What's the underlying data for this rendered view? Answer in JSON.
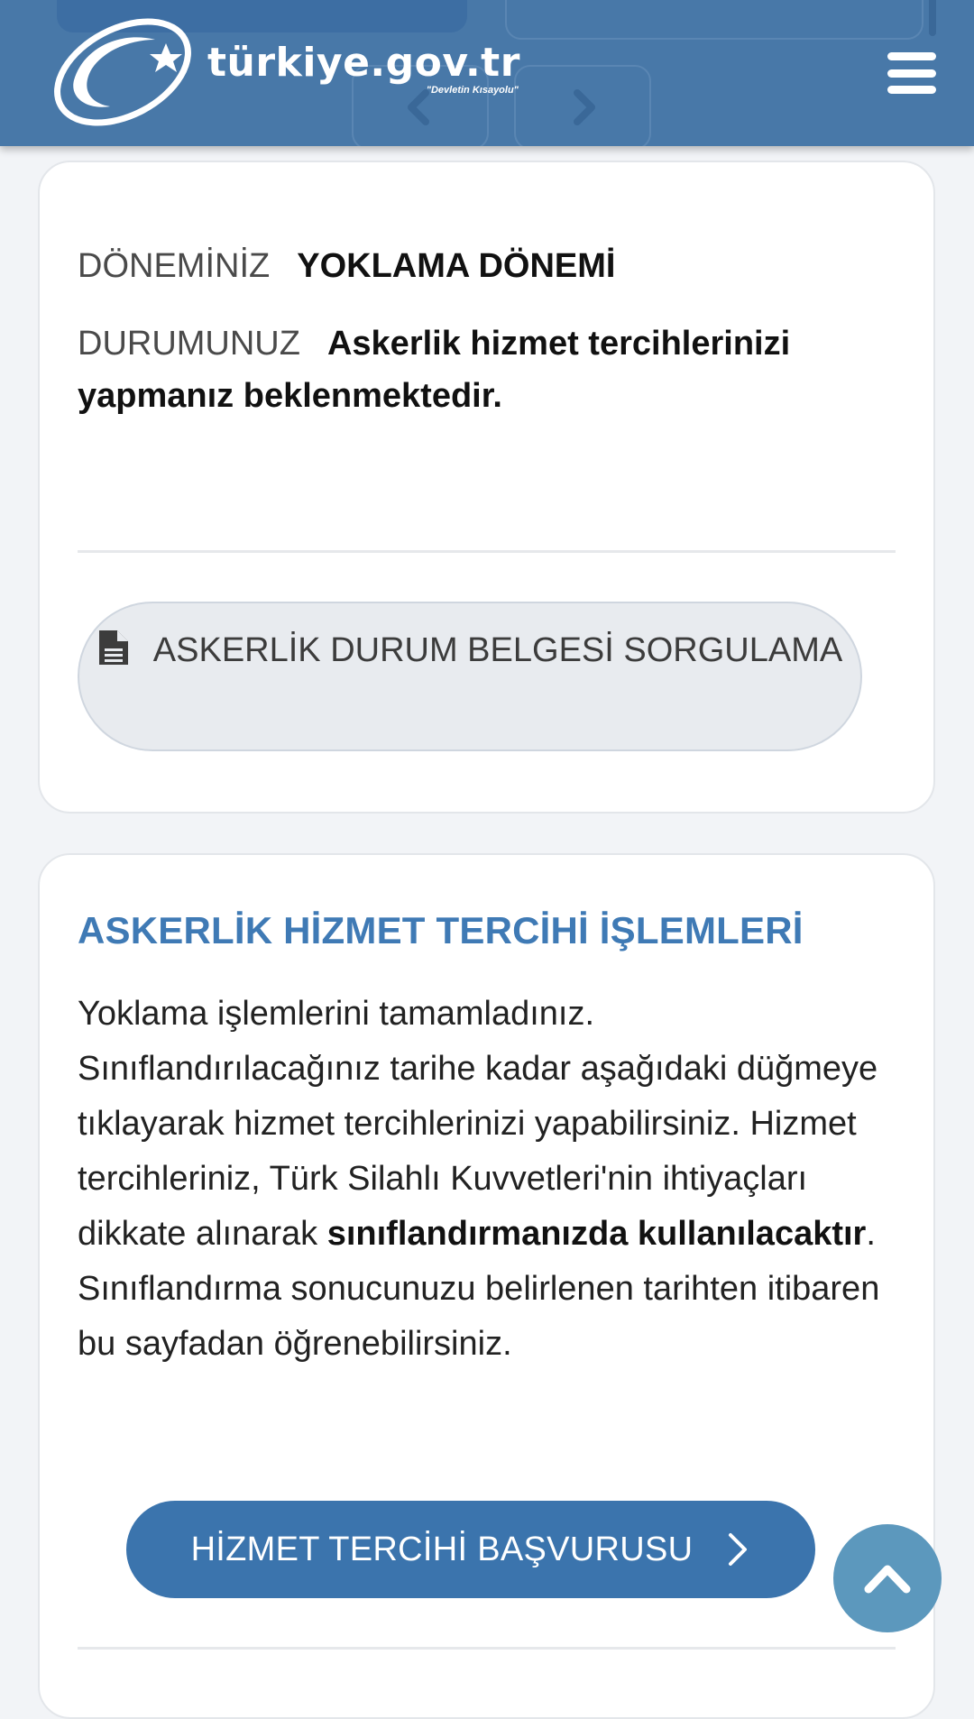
{
  "header": {
    "logo_name": "türkiye.gov.tr",
    "logo_slogan": "\"Devletin Kısayolu\"",
    "brand_color": "#4878a8"
  },
  "status_card": {
    "period_label": "DÖNEMİNİZ",
    "period_value": "YOKLAMA DÖNEMİ",
    "status_label": "DURUMUNUZ",
    "status_value": "Askerlik hizmet tercihlerinizi yapmanız beklenmektedir.",
    "document_button": {
      "label": "ASKERLİK DURUM BELGESİ SORGULAMA",
      "icon": "document-icon"
    }
  },
  "service_card": {
    "title": "ASKERLİK HİZMET TERCİHİ İŞLEMLERİ",
    "body_part1": "Yoklama işlemlerini tamamladınız. Sınıflandırılacağınız tarihe kadar aşağıdaki düğmeye tıklayarak hizmet tercihlerinizi yapabilirsiniz. Hizmet tercihleriniz, Türk Silahlı Kuvvetleri'nin ihtiyaçları dikkate alınarak ",
    "body_bold": "sınıflandırmanızda kullanılacaktır",
    "body_part2": ". Sınıflandırma sonucunuzu belirlenen tarihten itibaren bu sayfadan öğrenebilirsiniz.",
    "apply_button": {
      "label": "HİZMET TERCİHİ BAŞVURUSU",
      "icon": "chevron-right-icon"
    },
    "accent_color": "#3b74ad"
  }
}
